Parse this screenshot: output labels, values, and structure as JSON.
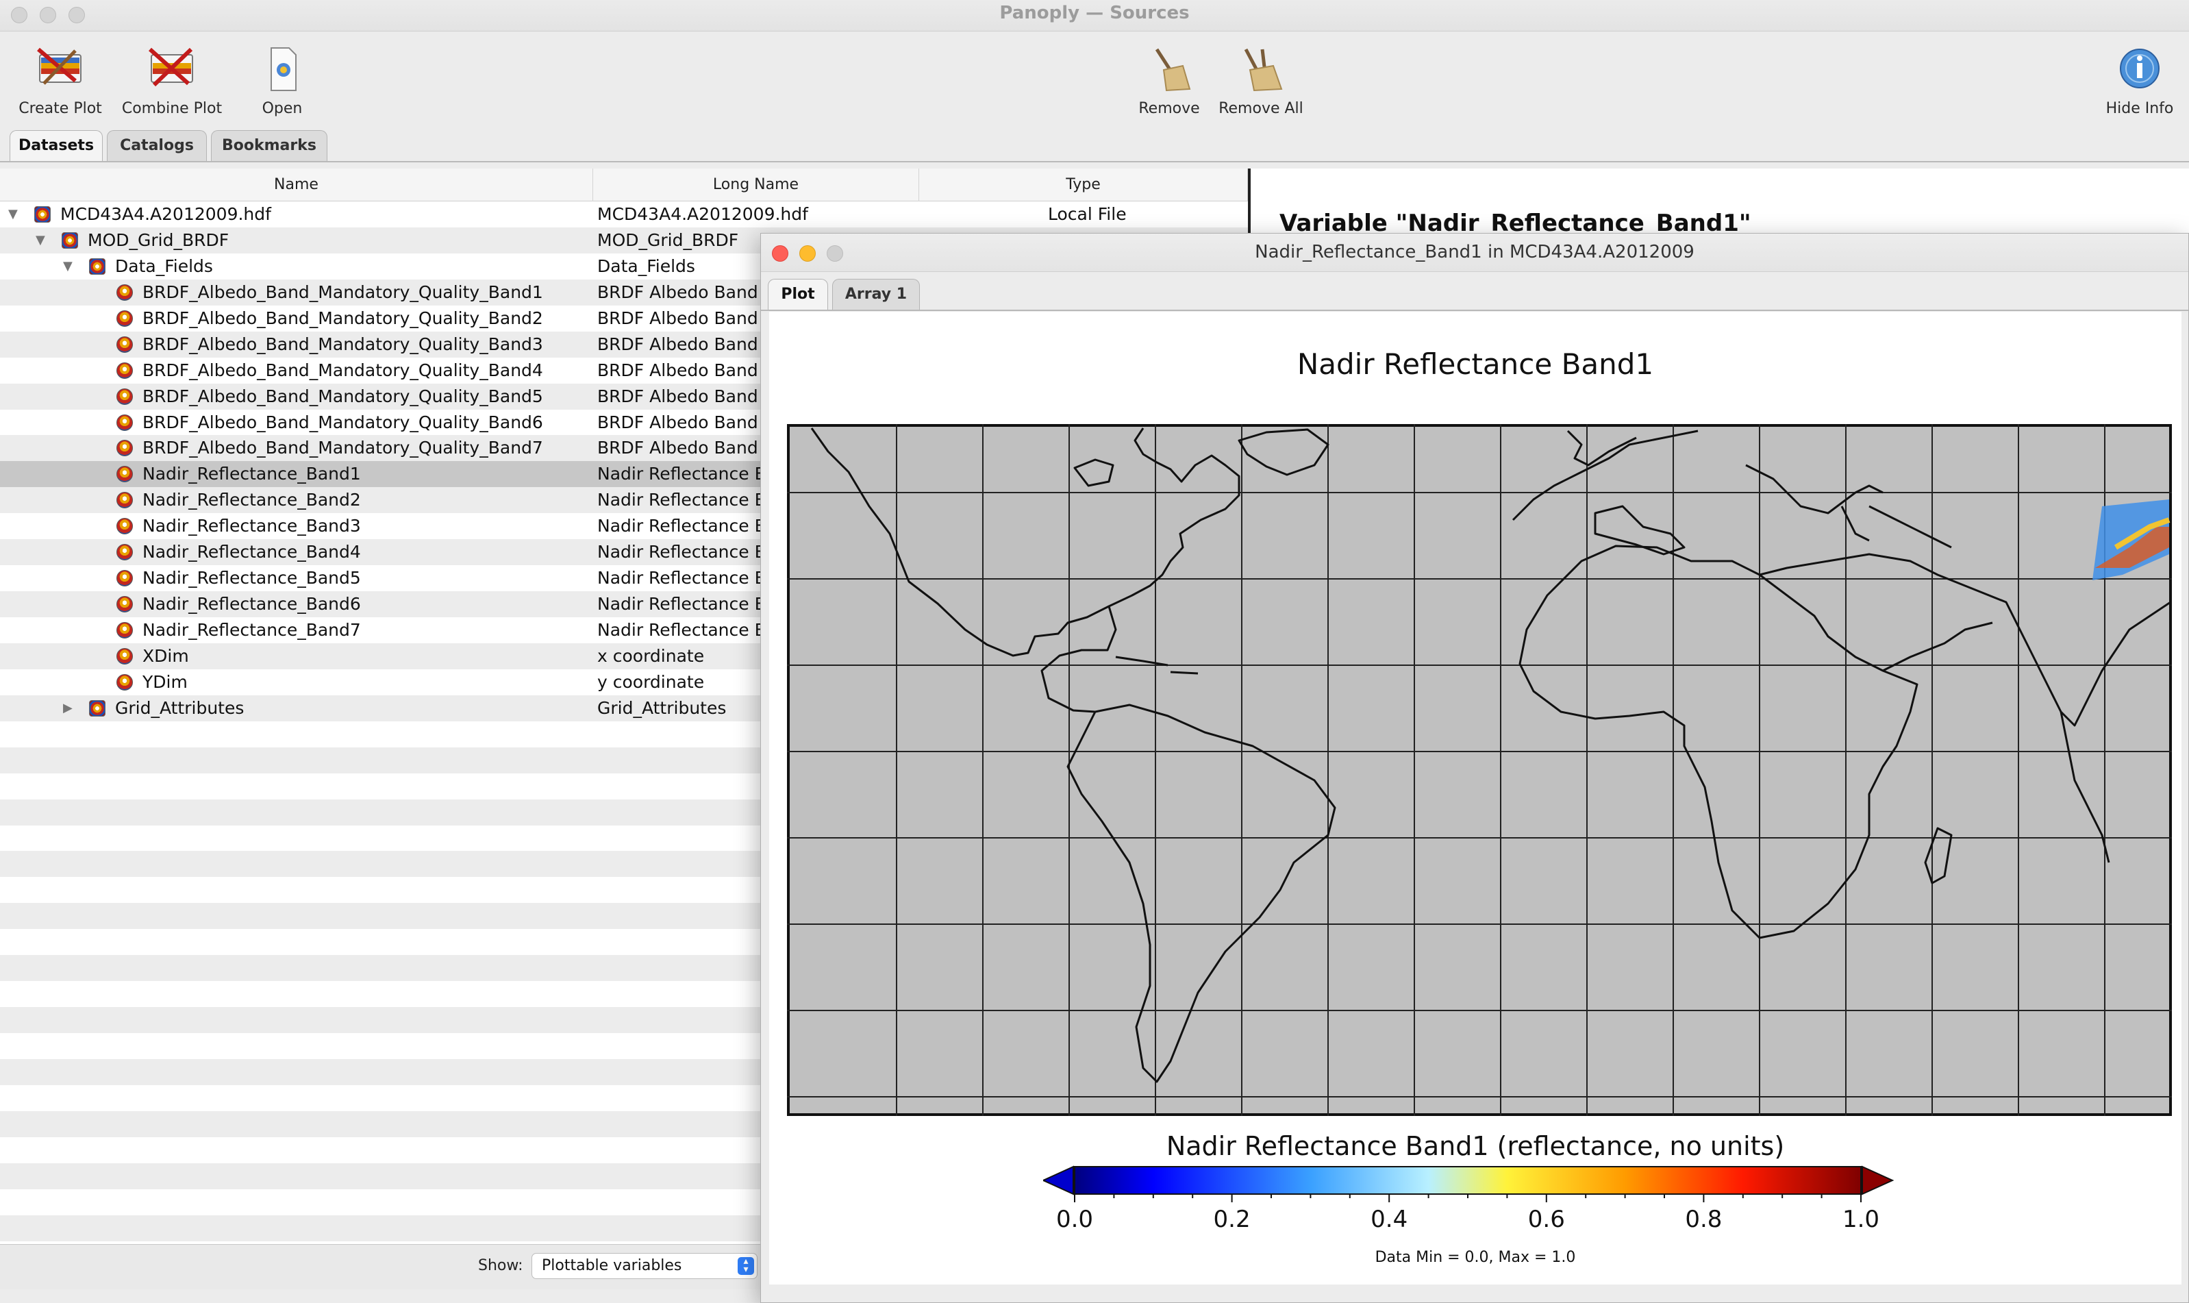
{
  "window": {
    "title": "Panoply — Sources"
  },
  "toolbar": {
    "create_plot": "Create Plot",
    "combine_plot": "Combine Plot",
    "open": "Open",
    "remove": "Remove",
    "remove_all": "Remove All",
    "hide_info": "Hide Info"
  },
  "tabs": [
    "Datasets",
    "Catalogs",
    "Bookmarks"
  ],
  "table": {
    "columns": [
      "Name",
      "Long Name",
      "Type"
    ],
    "rows": [
      {
        "name": "MCD43A4.A2012009.hdf",
        "long_name": "MCD43A4.A2012009.hdf",
        "type": "Local File",
        "level": 0,
        "icon": "dataset-icon",
        "expander": "open"
      },
      {
        "name": "MOD_Grid_BRDF",
        "long_name": "MOD_Grid_BRDF",
        "type": "",
        "level": 1,
        "icon": "group-icon",
        "expander": "open"
      },
      {
        "name": "Data_Fields",
        "long_name": "Data_Fields",
        "type": "",
        "level": 2,
        "icon": "group-icon",
        "expander": "open"
      },
      {
        "name": "BRDF_Albedo_Band_Mandatory_Quality_Band1",
        "long_name": "BRDF Albedo Band M",
        "type": "",
        "level": 3,
        "icon": "variable-icon"
      },
      {
        "name": "BRDF_Albedo_Band_Mandatory_Quality_Band2",
        "long_name": "BRDF Albedo Band M",
        "type": "",
        "level": 3,
        "icon": "variable-icon"
      },
      {
        "name": "BRDF_Albedo_Band_Mandatory_Quality_Band3",
        "long_name": "BRDF Albedo Band M",
        "type": "",
        "level": 3,
        "icon": "variable-icon"
      },
      {
        "name": "BRDF_Albedo_Band_Mandatory_Quality_Band4",
        "long_name": "BRDF Albedo Band M",
        "type": "",
        "level": 3,
        "icon": "variable-icon"
      },
      {
        "name": "BRDF_Albedo_Band_Mandatory_Quality_Band5",
        "long_name": "BRDF Albedo Band M",
        "type": "",
        "level": 3,
        "icon": "variable-icon"
      },
      {
        "name": "BRDF_Albedo_Band_Mandatory_Quality_Band6",
        "long_name": "BRDF Albedo Band M",
        "type": "",
        "level": 3,
        "icon": "variable-icon"
      },
      {
        "name": "BRDF_Albedo_Band_Mandatory_Quality_Band7",
        "long_name": "BRDF Albedo Band M",
        "type": "",
        "level": 3,
        "icon": "variable-icon"
      },
      {
        "name": "Nadir_Reflectance_Band1",
        "long_name": "Nadir Reflectance Ba",
        "type": "",
        "level": 3,
        "icon": "variable-icon",
        "selected": true
      },
      {
        "name": "Nadir_Reflectance_Band2",
        "long_name": "Nadir Reflectance Ba",
        "type": "",
        "level": 3,
        "icon": "variable-icon"
      },
      {
        "name": "Nadir_Reflectance_Band3",
        "long_name": "Nadir Reflectance Ba",
        "type": "",
        "level": 3,
        "icon": "variable-icon"
      },
      {
        "name": "Nadir_Reflectance_Band4",
        "long_name": "Nadir Reflectance Ba",
        "type": "",
        "level": 3,
        "icon": "variable-icon"
      },
      {
        "name": "Nadir_Reflectance_Band5",
        "long_name": "Nadir Reflectance Ba",
        "type": "",
        "level": 3,
        "icon": "variable-icon"
      },
      {
        "name": "Nadir_Reflectance_Band6",
        "long_name": "Nadir Reflectance Ba",
        "type": "",
        "level": 3,
        "icon": "variable-icon"
      },
      {
        "name": "Nadir_Reflectance_Band7",
        "long_name": "Nadir Reflectance Ba",
        "type": "",
        "level": 3,
        "icon": "variable-icon"
      },
      {
        "name": "XDim",
        "long_name": "x coordinate",
        "type": "",
        "level": 3,
        "icon": "variable-icon"
      },
      {
        "name": "YDim",
        "long_name": "y coordinate",
        "type": "",
        "level": 3,
        "icon": "variable-icon"
      },
      {
        "name": "Grid_Attributes",
        "long_name": "Grid_Attributes",
        "type": "",
        "level": 2,
        "icon": "group-icon",
        "expander": "closed"
      }
    ]
  },
  "show": {
    "label": "Show:",
    "value": "Plottable variables"
  },
  "info": {
    "title": "Variable \"Nadir_Reflectance_Band1\""
  },
  "plot_window": {
    "title": "Nadir_Reflectance_Band1 in MCD43A4.A2012009",
    "tabs": [
      "Plot",
      "Array 1"
    ],
    "plot_title": "Nadir Reflectance Band1",
    "colorbar_title": "Nadir Reflectance Band1 (reflectance, no units)",
    "colorbar_ticks": [
      "0.0",
      "0.2",
      "0.4",
      "0.6",
      "0.8",
      "1.0"
    ],
    "data_min_max": "Data Min = 0.0, Max = 1.0"
  },
  "colors": {
    "map_background": "#c0c0c0",
    "selection": "#c7c7c7",
    "close": "#fe5f57",
    "minimize": "#febc2e",
    "zoom": "#d0d0d0"
  }
}
